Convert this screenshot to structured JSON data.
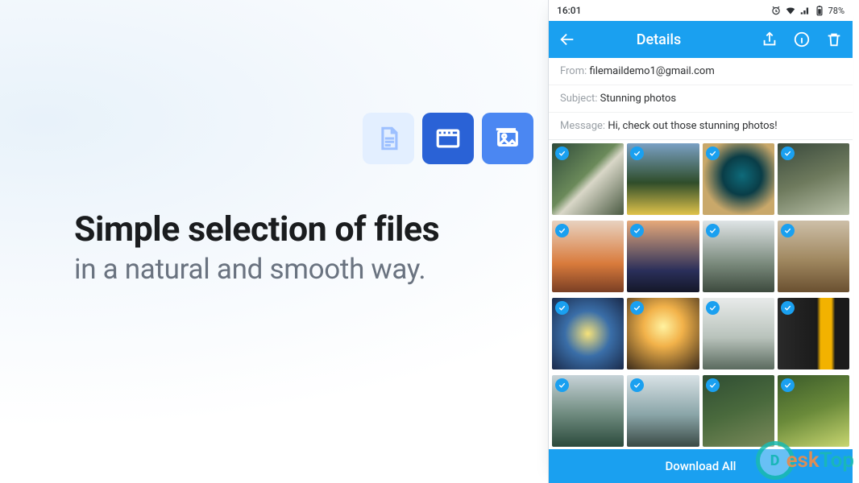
{
  "marketing": {
    "headline1": "Simple selection of files",
    "headline2": "in a natural and smooth way."
  },
  "statusbar": {
    "time": "16:01",
    "battery": "78%"
  },
  "appbar": {
    "title": "Details"
  },
  "details": {
    "from_label": "From: ",
    "from_value": "filemaildemo1@gmail.com",
    "subject_label": "Subject: ",
    "subject_value": "Stunning photos",
    "message_label": "Message: ",
    "message_value": "Hi, check out those stunning photos!"
  },
  "download_label": "Download All",
  "thumbs": [
    {
      "bg": "linear-gradient(135deg,#2e4a3a 0%,#6b8a5a 45%,#d9d7c8 55%,#4a5a42 100%)"
    },
    {
      "bg": "linear-gradient(180deg,#7aa0c4 0%,#2f4d2a 55%,#e0c34a 100%)"
    },
    {
      "bg": "radial-gradient(circle at 55% 45%,#0e6a7a 0%,#0a3d47 35%,#c9a86a 70%)"
    },
    {
      "bg": "linear-gradient(160deg,#3a4a3d 0%,#6e7a5d 50%,#b8c0a8 100%)"
    },
    {
      "bg": "linear-gradient(180deg,#e8d2c0 0%,#d97b3c 60%,#7a3f24 100%)"
    },
    {
      "bg": "linear-gradient(180deg,#e6a97a 0%,#2a2f5a 70%,#141728 100%)"
    },
    {
      "bg": "linear-gradient(180deg,#dfe4e6 0%,#7a8a7c 60%,#3d4a3e 100%)"
    },
    {
      "bg": "linear-gradient(180deg,#cdbfa8 0%,#a08860 55%,#6a5030 100%)"
    },
    {
      "bg": "radial-gradient(circle at 50% 50%,#f6e27a 0%,#3a6ea8 45%,#1a2a4a 100%)"
    },
    {
      "bg": "radial-gradient(circle at 50% 40%,#fff2a0 0%,#f2b24a 35%,#3a2a1a 100%)"
    },
    {
      "bg": "linear-gradient(180deg,#e8ebea 0%,#b9c3bc 55%,#5a6a5e 100%)"
    },
    {
      "bg": "linear-gradient(90deg,#2a2a2a 0%,#1a1a1a 55%,#f2b200 60%,#f2b200 75%,#1a1a1a 80%)"
    },
    {
      "bg": "linear-gradient(180deg,#c7d3d8 0%,#6e8a7e 55%,#2b4a3c 100%)"
    },
    {
      "bg": "linear-gradient(180deg,#d9e2e6 0%,#8aa5a8 55%,#3a4a45 100%)"
    },
    {
      "bg": "linear-gradient(160deg,#2f4d33 0%,#4a6a3d 50%,#7a8a5a 100%)"
    },
    {
      "bg": "linear-gradient(160deg,#3a5a2a 0%,#6a8a3a 50%,#c8d670 100%)"
    }
  ],
  "watermark": {
    "part1": "D",
    "part2": "esk",
    "part3": "Top"
  }
}
